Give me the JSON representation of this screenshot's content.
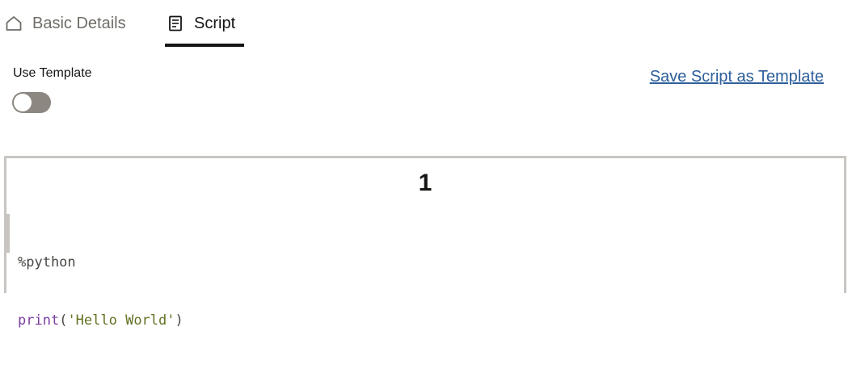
{
  "tabs": [
    {
      "label": "Basic Details",
      "icon": "home-icon",
      "active": false
    },
    {
      "label": "Script",
      "icon": "script-icon",
      "active": true
    }
  ],
  "template": {
    "use_template_label": "Use Template",
    "toggle_on": false,
    "save_link_label": "Save Script as Template"
  },
  "editor": {
    "paragraph_number": "1",
    "lines": [
      {
        "text": "%python"
      },
      {
        "fn": "print",
        "open": "(",
        "string": "'Hello World'",
        "close": ")"
      }
    ]
  },
  "colors": {
    "active_tab_underline": "#161513",
    "link": "#2d5f9b",
    "toggle_off": "#8c8781",
    "code_function": "#7a3fa0",
    "code_string": "#617322"
  }
}
